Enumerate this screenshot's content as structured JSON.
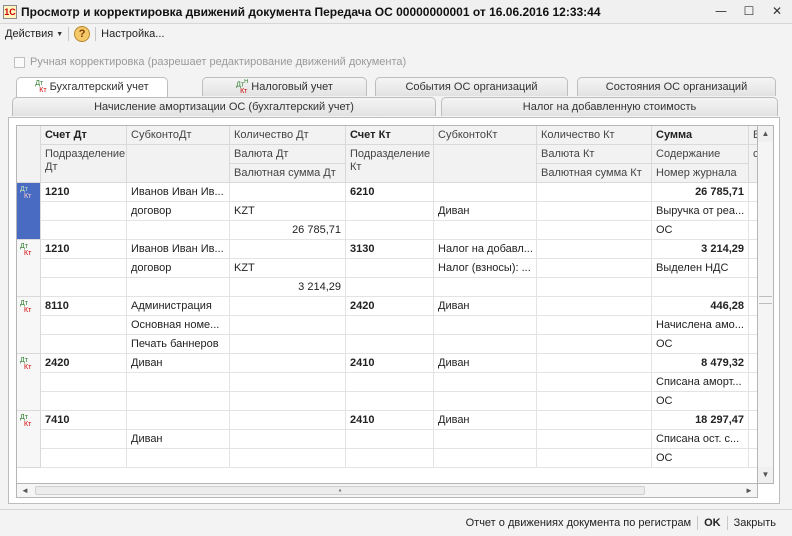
{
  "window": {
    "title": "Просмотр и корректировка движений документа Передача ОС 00000000001 от 16.06.2016 12:33:44",
    "icon_glyph": "1С",
    "min_glyph": "—",
    "max_glyph": "☐",
    "close_glyph": "✕"
  },
  "toolbar": {
    "actions_label": "Действия",
    "help_glyph": "?",
    "settings_label": "Настройка..."
  },
  "manual_edit": {
    "label": "Ручная корректировка (разрешает редактирование движений документа)",
    "checked": false
  },
  "tabs_row1": [
    {
      "label": "Бухгалтерский учет",
      "active": true,
      "icon": "dt-kt-icon"
    },
    {
      "label": "Налоговый учет",
      "active": false,
      "icon": "dt-kt-h-icon"
    },
    {
      "label": "События ОС организаций",
      "active": false
    },
    {
      "label": "Состояния ОС организаций",
      "active": false
    }
  ],
  "tabs_row2": [
    {
      "label": "Начисление амортизации ОС (бухгалтерский учет)"
    },
    {
      "label": "Налог на добавленную стоимость"
    }
  ],
  "dk": {
    "d": "Дт",
    "k": "Кт",
    "h": "Н"
  },
  "grid": {
    "headers": {
      "row1": [
        "Счет Дт",
        "СубконтоДт",
        "Количество Дт",
        "Счет Кт",
        "СубконтоКт",
        "Количество Кт",
        "Сумма",
        "В"
      ],
      "row2": [
        "Подразделение Дт",
        "",
        "Валюта Дт",
        "Подразделение Кт",
        "",
        "Валюта Кт",
        "Содержание",
        "с"
      ],
      "row3": [
        "",
        "",
        "Валютная сумма Дт",
        "",
        "",
        "Валютная сумма Кт",
        "Номер журнала",
        ""
      ]
    },
    "rows": [
      {
        "selected": true,
        "account_dt": "1210",
        "subconto_dt": [
          "Иванов Иван Ив...",
          "договор",
          ""
        ],
        "qty_dt": [
          "",
          "KZT",
          "26 785,71"
        ],
        "account_kt": "6210",
        "subconto_kt": [
          "",
          "Диван",
          ""
        ],
        "qty_kt": [
          "",
          "",
          ""
        ],
        "sum": [
          "26 785,71",
          "Выручка от реа...",
          "ОС"
        ]
      },
      {
        "selected": false,
        "account_dt": "1210",
        "subconto_dt": [
          "Иванов Иван Ив...",
          "договор",
          ""
        ],
        "qty_dt": [
          "",
          "KZT",
          "3 214,29"
        ],
        "account_kt": "3130",
        "subconto_kt": [
          "Налог на добавл...",
          "Налог (взносы): ...",
          ""
        ],
        "qty_kt": [
          "",
          "",
          ""
        ],
        "sum": [
          "3 214,29",
          "Выделен НДС",
          ""
        ]
      },
      {
        "selected": false,
        "account_dt": "8110",
        "subconto_dt": [
          "Администрация",
          "Основная номе...",
          "Печать баннеров"
        ],
        "qty_dt": [
          "",
          "",
          ""
        ],
        "account_kt": "2420",
        "subconto_kt": [
          "Диван",
          "",
          ""
        ],
        "qty_kt": [
          "",
          "",
          ""
        ],
        "sum": [
          "446,28",
          "Начислена амо...",
          "ОС"
        ]
      },
      {
        "selected": false,
        "account_dt": "2420",
        "subconto_dt": [
          "Диван",
          "",
          ""
        ],
        "qty_dt": [
          "",
          "",
          ""
        ],
        "account_kt": "2410",
        "subconto_kt": [
          "Диван",
          "",
          ""
        ],
        "qty_kt": [
          "",
          "",
          ""
        ],
        "sum": [
          "8 479,32",
          "Списана аморт...",
          "ОС"
        ]
      },
      {
        "selected": false,
        "account_dt": "7410",
        "subconto_dt": [
          "",
          "Диван",
          ""
        ],
        "qty_dt": [
          "",
          "",
          ""
        ],
        "account_kt": "2410",
        "subconto_kt": [
          "Диван",
          "",
          ""
        ],
        "qty_kt": [
          "",
          "",
          ""
        ],
        "sum": [
          "18 297,47",
          "Списана ост. с...",
          "ОС"
        ]
      }
    ]
  },
  "scroll": {
    "up": "▲",
    "down": "▼",
    "left": "◄",
    "right": "►",
    "grip": "▪"
  },
  "footer": {
    "report_label": "Отчет о движениях документа по регистрам",
    "ok_label": "OK",
    "close_label": "Закрыть"
  }
}
